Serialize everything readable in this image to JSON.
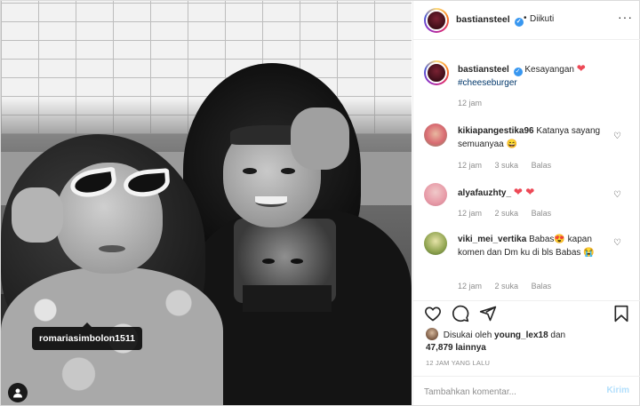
{
  "photo": {
    "tag_username": "romariasimbolon1511",
    "alt": ""
  },
  "header": {
    "username": "bastiansteel",
    "verified_mark": "✓",
    "dot": "•",
    "follow_status": "Diikuti",
    "more": "···"
  },
  "caption": {
    "username": "bastiansteel",
    "text": "Kesayangan",
    "emoji": "❤",
    "hashtag": "#cheeseburger",
    "time": "12 jam"
  },
  "comments": [
    {
      "username": "kikiapangestika96",
      "text": "Katanya sayang semuanyaa",
      "emoji": "😄",
      "time": "12 jam",
      "likes": "3 suka",
      "reply": "Balas"
    },
    {
      "username": "alyafauzhty_",
      "text": "",
      "emoji": "❤ ❤",
      "time": "12 jam",
      "likes": "2 suka",
      "reply": "Balas"
    },
    {
      "username": "viki_mei_vertika",
      "text_a": "Babas",
      "emoji_a": "😍",
      "text_b": "kapan komen dan Dm ku di bls Babas",
      "emoji_b": "😭",
      "time": "12 jam",
      "likes": "2 suka",
      "reply": "Balas"
    }
  ],
  "likes": {
    "prefix": "Disukai oleh",
    "user": "young_lex18",
    "conj": "dan",
    "count": "47,879 lainnya"
  },
  "timestamp": "12 JAM YANG LALU",
  "comment_box": {
    "placeholder": "Tambahkan komentar...",
    "post_label": "Kirim"
  },
  "colors": {
    "verified": "#3897f0",
    "heart": "#ed4956",
    "link": "#00376b",
    "muted": "#8e8e8e",
    "post_disabled": "#b2dffc"
  },
  "icons": {
    "like": "heart-outline",
    "comment": "speech-bubble",
    "share": "paper-plane",
    "save": "bookmark",
    "tag_user": "person"
  }
}
